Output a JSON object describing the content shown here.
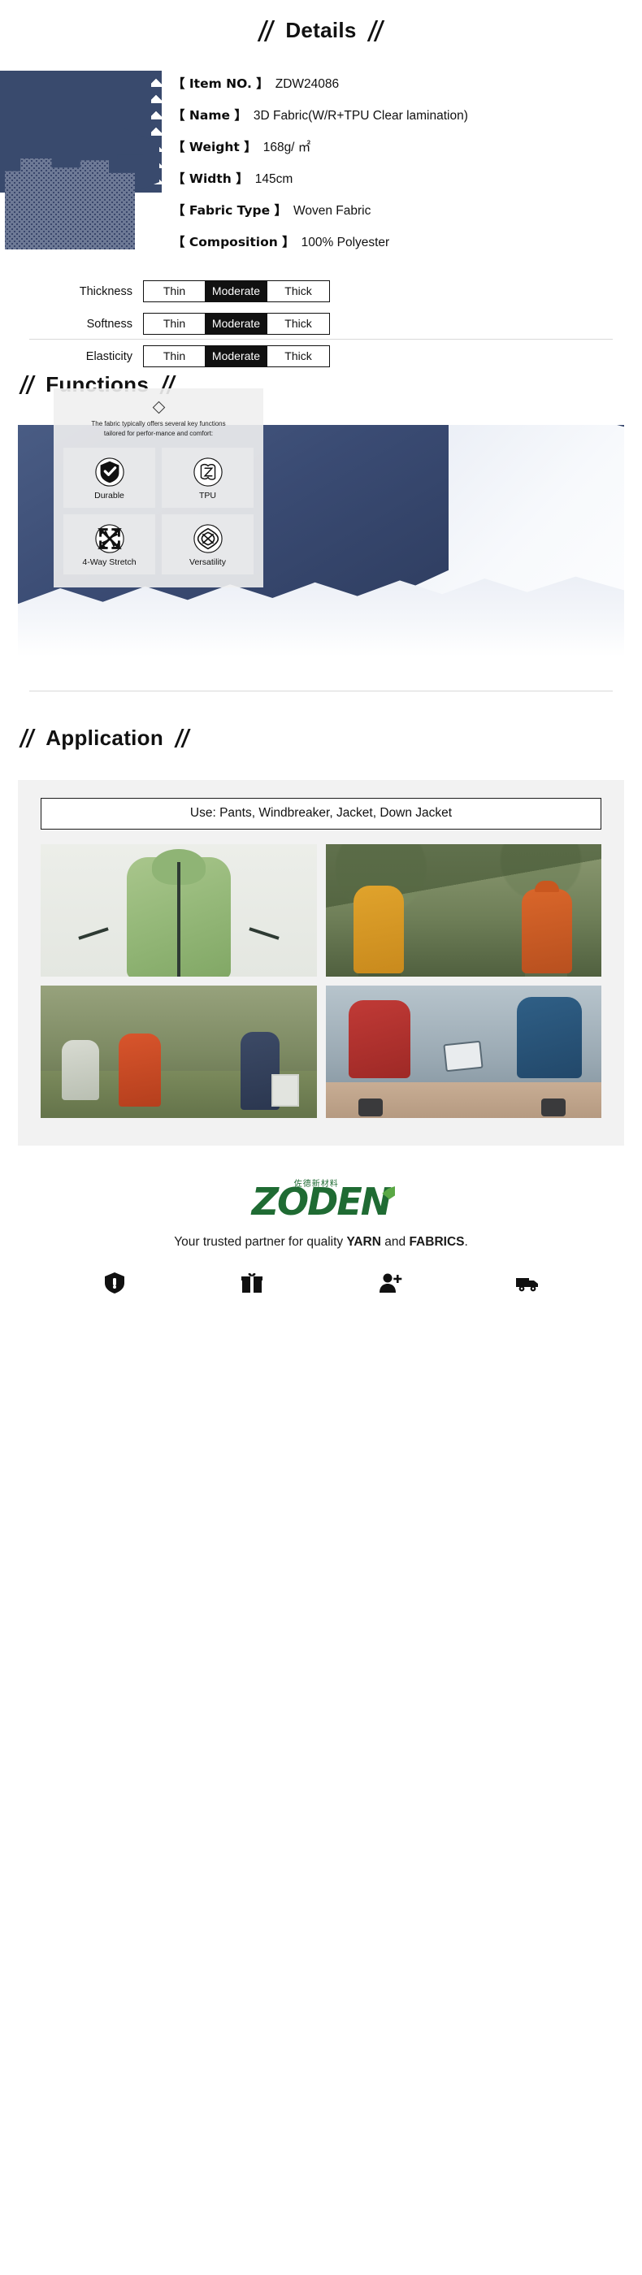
{
  "details": {
    "heading": "Details",
    "specs": [
      {
        "key": "【 Item NO. 】",
        "value": "ZDW24086"
      },
      {
        "key": "【 Name 】",
        "value": "3D Fabric(W/R+TPU Clear lamination)"
      },
      {
        "key": "【 Weight 】",
        "value": "168g/ ㎡"
      },
      {
        "key": "【 Width 】",
        "value": "145cm"
      },
      {
        "key": "【 Fabric Type 】",
        "value": "Woven Fabric"
      },
      {
        "key": "【 Composition 】",
        "value": "100% Polyester"
      }
    ],
    "ratings": [
      {
        "label": "Thickness",
        "options": [
          "Thin",
          "Moderate",
          "Thick"
        ],
        "selected": "Moderate"
      },
      {
        "label": "Softness",
        "options": [
          "Thin",
          "Moderate",
          "Thick"
        ],
        "selected": "Moderate"
      },
      {
        "label": "Elasticity",
        "options": [
          "Thin",
          "Moderate",
          "Thick"
        ],
        "selected": "Moderate"
      }
    ]
  },
  "functions": {
    "heading": "Functions",
    "description": "The fabric typically offers several key functions tailored for perfor-mance and comfort:",
    "cards": [
      {
        "icon": "shield-check-icon",
        "label": "Durable"
      },
      {
        "icon": "tpu-film-icon",
        "label": "TPU"
      },
      {
        "icon": "four-way-stretch-icon",
        "label": "4-Way Stretch"
      },
      {
        "icon": "versatility-knot-icon",
        "label": "Versatility"
      }
    ]
  },
  "application": {
    "heading": "Application",
    "use_banner": "Use: Pants, Windbreaker, Jacket, Down Jacket",
    "photos": [
      "green-jacket-product-photo",
      "two-hikers-outdoor-photo",
      "family-outdoor-photo",
      "couple-with-tablet-photo"
    ]
  },
  "footer": {
    "logo_text": "ZODEN",
    "logo_cn": "佐德新材料",
    "tagline_prefix": "Your trusted partner for quality ",
    "tagline_yarn": "YARN",
    "tagline_mid": " and ",
    "tagline_fabrics": "FABRICS",
    "tagline_suffix": ".",
    "service_icons": [
      "shield-quality-icon",
      "gift-box-icon",
      "user-add-icon",
      "delivery-truck-icon"
    ]
  },
  "colors": {
    "navy": "#394a6d",
    "brand_green": "#1f6b33",
    "leaf_green": "#5aa845",
    "panel_gray": "#f2f2f2"
  }
}
